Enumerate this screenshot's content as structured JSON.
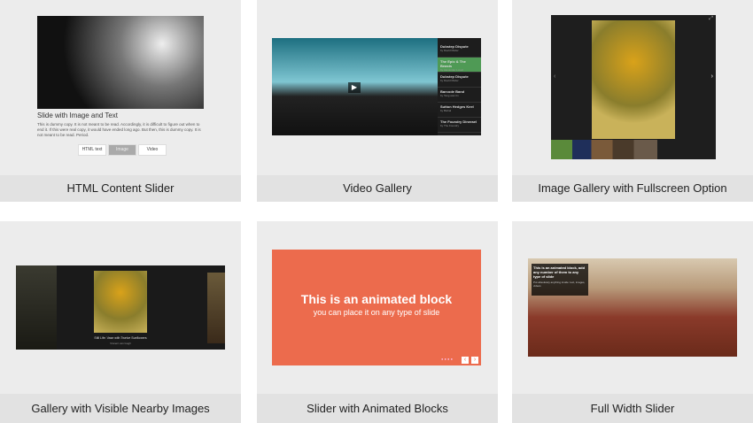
{
  "cards": [
    {
      "caption": "HTML Content Slider",
      "slide_title": "Slide with Image and Text",
      "slide_body": "This is dummy copy. It is not meant to be read. Accordingly, it is difficult to figure out when to end it. If this were real copy, it would have ended long ago. But then, this is dummy copy. It is not meant to be read. Period.",
      "buttons": [
        "HTML text",
        "Image",
        "Video"
      ],
      "active_button": "Image"
    },
    {
      "caption": "Video Gallery",
      "playlist": [
        {
          "title": "Dubstep Dispute",
          "by": "by David Meiler"
        },
        {
          "title": "The Epic & The Beasts",
          "by": "by Alexander Lovell"
        },
        {
          "title": "Dubstep Dispute",
          "by": "by David Meiler"
        },
        {
          "title": "Barcode Band",
          "by": "by Tang wan lin"
        },
        {
          "title": "Sutton Hedges Keel",
          "by": "by Bishal"
        },
        {
          "title": "The Foundry Dinerael",
          "by": "by The Foundry"
        }
      ]
    },
    {
      "caption": "Image Gallery with Fullscreen Option"
    },
    {
      "caption": "Gallery with Visible Nearby Images",
      "image_caption": "Still Life: Vase with Twelve Sunflowers",
      "image_sub": "Vincent van Gogh"
    },
    {
      "caption": "Slider with Animated Blocks",
      "block_title": "This is an animated block",
      "block_sub": "you can place it on any type of slide",
      "accent": "#ec6b4d"
    },
    {
      "caption": "Full Width Slider",
      "overlay_title": "This is an animated block, add any number of them to any type of slide",
      "overlay_sub": "Put absolutely anything inside: text, images, videos"
    }
  ]
}
